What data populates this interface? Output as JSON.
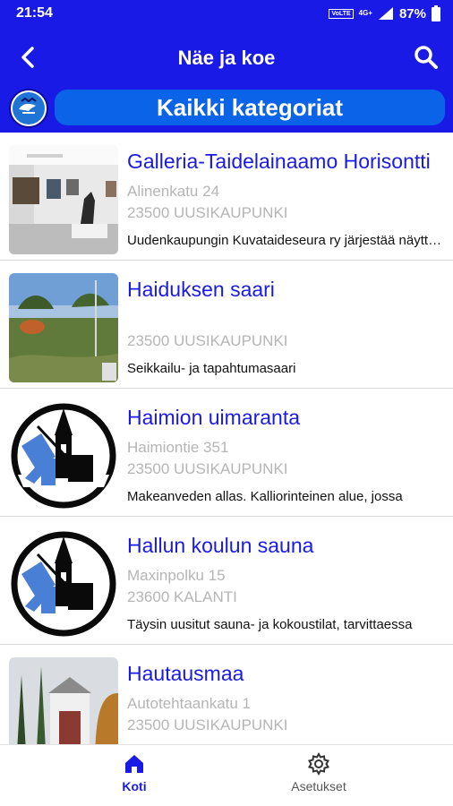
{
  "status_bar": {
    "time": "21:54",
    "volte": "VoLTE",
    "network": "4G+",
    "battery": "87%"
  },
  "app_bar": {
    "title": "Näe ja koe"
  },
  "category": {
    "label": "Kaikki kategoriat"
  },
  "items": [
    {
      "name": "Galleria-Taidelainaamo Horisontti",
      "address_line1": "Alinenkatu 24",
      "address_line2": "23500 UUSIKAUPUNKI",
      "description": "Uudenkaupungin Kuvataideseura ry järjestää näyttelyitä"
    },
    {
      "name": "Haiduksen saari",
      "address_line1": "",
      "address_line2": "23500 UUSIKAUPUNKI",
      "description": "Seikkailu- ja tapahtumasaari"
    },
    {
      "name": "Haimion uimaranta",
      "address_line1": "Haimiontie 351",
      "address_line2": "23500 UUSIKAUPUNKI",
      "description": "Makeanveden allas. Kalliorinteinen alue, jossa"
    },
    {
      "name": "Hallun koulun sauna",
      "address_line1": "Maxinpolku 15",
      "address_line2": "23600 KALANTI",
      "description": "Täysin uusitut sauna- ja kokoustilat, tarvittaessa"
    },
    {
      "name": "Hautausmaa",
      "address_line1": "Autotehtaankatu 1",
      "address_line2": "23500 UUSIKAUPUNKI",
      "description": ""
    }
  ],
  "bottom_nav": {
    "home_label": "Koti",
    "settings_label": "Asetukset"
  },
  "colors": {
    "primary": "#1a1ae6",
    "category_button": "#0b63e8",
    "address_gray": "#b5b5b5"
  }
}
